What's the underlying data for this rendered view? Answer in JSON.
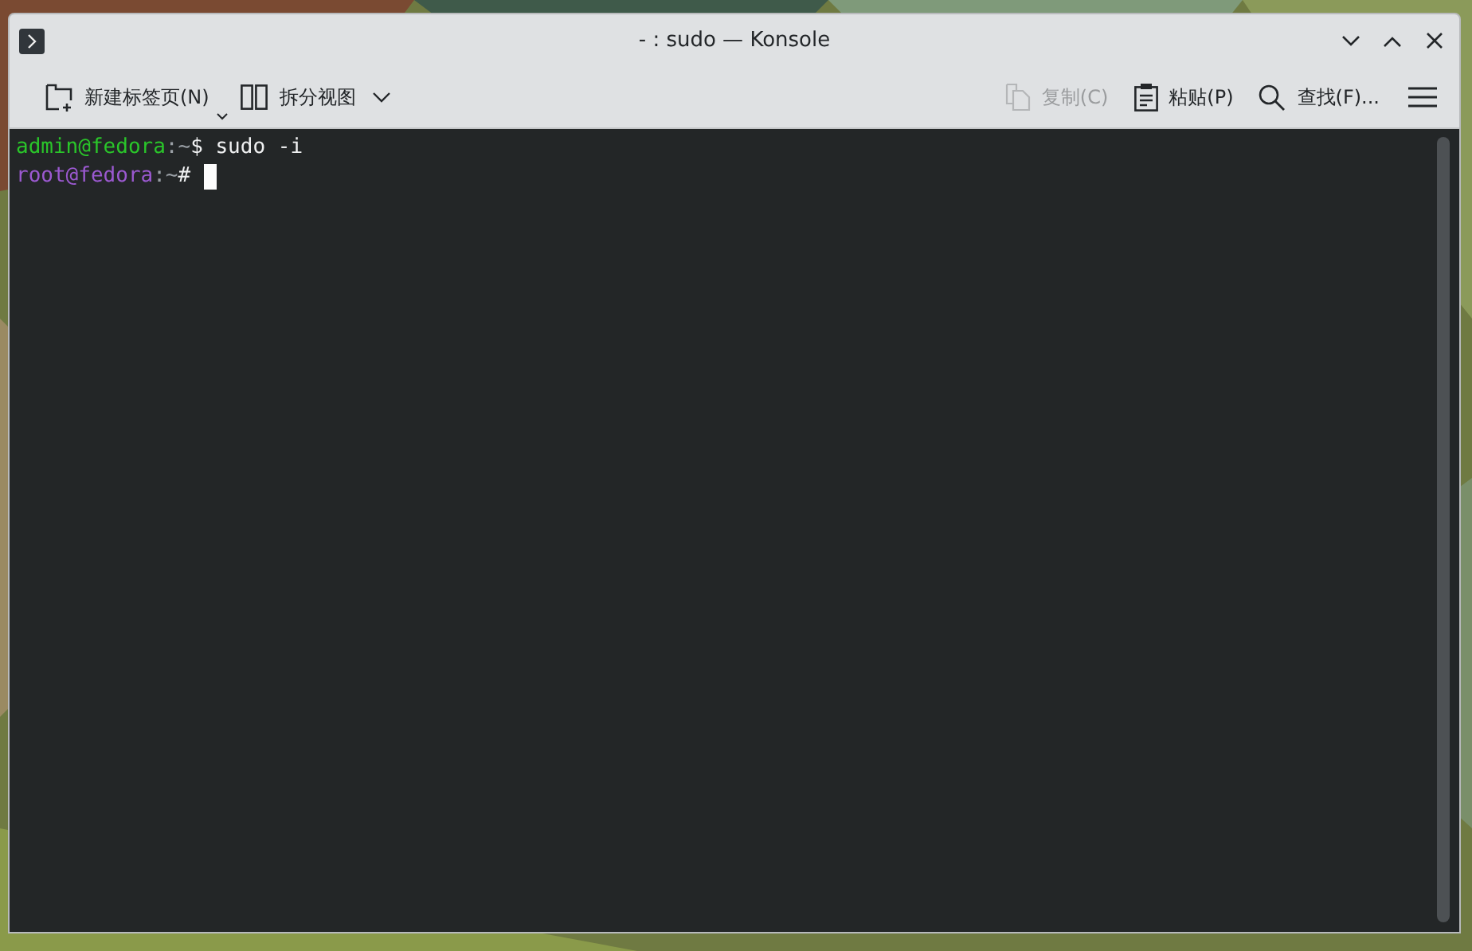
{
  "window": {
    "title": "- : sudo — Konsole"
  },
  "toolbar": {
    "items": [
      {
        "label": "新建标签页(N)",
        "kind": "new-tab",
        "disabled": false,
        "menu": true
      },
      {
        "label": "拆分视图",
        "kind": "split-view",
        "disabled": false,
        "menu": true
      },
      {
        "label": "复制(C)",
        "kind": "copy",
        "disabled": true,
        "menu": false
      },
      {
        "label": "粘贴(P)",
        "kind": "paste",
        "disabled": false,
        "menu": false
      },
      {
        "label": "查找(F)...",
        "kind": "find",
        "disabled": false,
        "menu": false
      }
    ]
  },
  "terminal": {
    "lines": [
      {
        "segments": [
          {
            "text": "admin@fedora",
            "kind": "user"
          },
          {
            "text": ":~",
            "kind": "path"
          },
          {
            "text": "$ sudo -i",
            "kind": "input"
          }
        ],
        "cursor": false
      },
      {
        "segments": [
          {
            "text": "root@fedora",
            "kind": "root"
          },
          {
            "text": ":~",
            "kind": "path"
          },
          {
            "text": "#",
            "kind": "input"
          }
        ],
        "cursor": true
      }
    ]
  }
}
